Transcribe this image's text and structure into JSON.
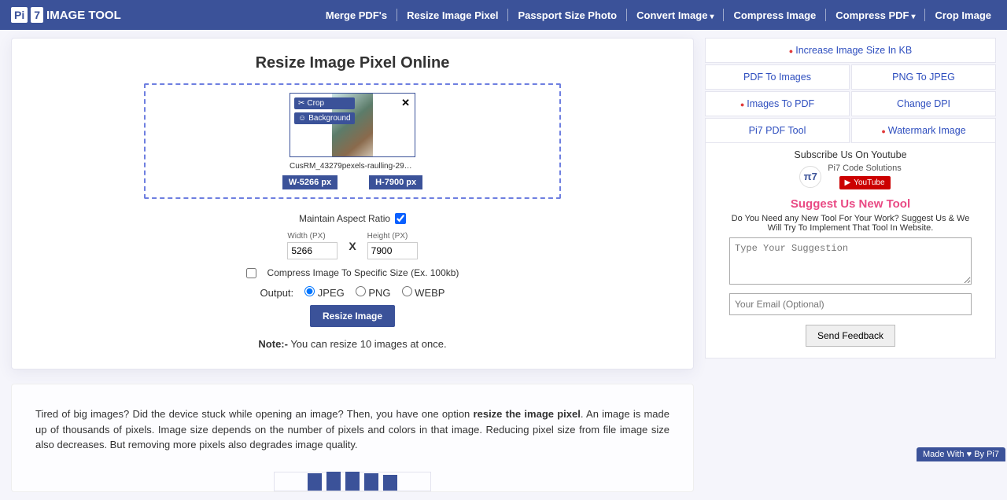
{
  "brand": {
    "pi": "Pi",
    "seven": "7",
    "name": "IMAGE TOOL"
  },
  "nav": {
    "merge": "Merge PDF's",
    "resize": "Resize Image Pixel",
    "passport": "Passport Size Photo",
    "convert": "Convert Image",
    "compress_img": "Compress Image",
    "compress_pdf": "Compress PDF",
    "crop": "Crop Image"
  },
  "page_title": "Resize Image Pixel Online",
  "thumb": {
    "crop": "Crop",
    "background": "Background",
    "filename": "CusRM_43279pexels-raulling-29799788.j…",
    "w_tag": "W-5266 px",
    "h_tag": "H-7900 px"
  },
  "maintain_label": "Maintain Aspect Ratio",
  "dims": {
    "width_label": "Width (PX)",
    "height_label": "Height (PX)",
    "width": "5266",
    "height": "7900"
  },
  "compress_label": "Compress Image To Specific Size (Ex. 100kb)",
  "output": {
    "label": "Output:",
    "jpeg": "JPEG",
    "png": "PNG",
    "webp": "WEBP"
  },
  "resize_btn": "Resize Image",
  "note_prefix": "Note:-",
  "note_text": " You can resize 10 images at once.",
  "article": {
    "p1a": "Tired of big images? Did the device stuck while opening an image? Then, you have one option ",
    "p1b": "resize the image pixel",
    "p1c": ". An image is made up of thousands of pixels. Image size depends on the number of pixels and colors in that image. Reducing pixel size from file image size also decreases. But removing more pixels also degrades image quality."
  },
  "side_links": {
    "increase": "Increase Image Size In KB",
    "pdf_to_images": "PDF To Images",
    "png_to_jpeg": "PNG To JPEG",
    "images_to_pdf": "Images To PDF",
    "change_dpi": "Change DPI",
    "pi7_pdf_tool": "Pi7 PDF Tool",
    "watermark": "Watermark Image"
  },
  "subscribe": {
    "title": "Subscribe Us On Youtube",
    "channel": "Pi7 Code Solutions",
    "avatar": "π7",
    "yt": "YouTube"
  },
  "suggest": {
    "title": "Suggest Us New Tool",
    "desc": "Do You Need any New Tool For Your Work? Suggest Us & We Will Try To Implement That Tool In Website.",
    "placeholder": "Type Your Suggestion",
    "email_placeholder": "Your Email (Optional)",
    "button": "Send Feedback"
  },
  "footer": {
    "made": "Made With ",
    "by": " By  Pi7"
  }
}
